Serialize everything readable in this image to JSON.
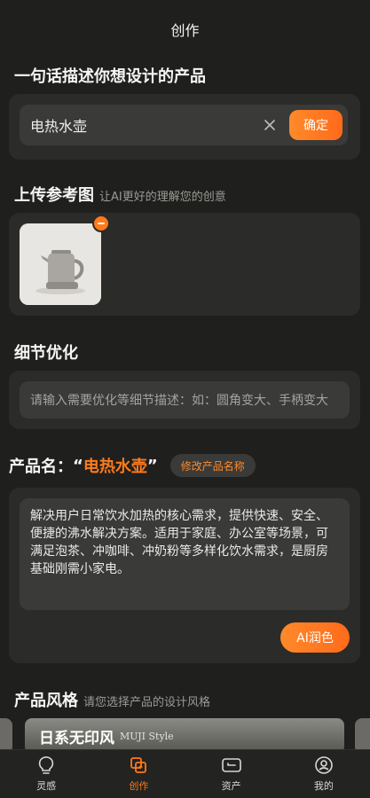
{
  "header": {
    "title": "创作"
  },
  "describe": {
    "title": "一句话描述你想设计的产品",
    "input_value": "电热水壶",
    "confirm_label": "确定"
  },
  "reference": {
    "title": "上传参考图",
    "hint": "让AI更好的理解您的创意",
    "image_icon": "kettle-image"
  },
  "detail": {
    "title": "细节优化",
    "placeholder": "请输入需要优化等细节描述：如：圆角变大、手柄变大"
  },
  "product": {
    "label": "产品名：",
    "open_quote": "“",
    "name": "电热水壶",
    "close_quote": "”",
    "rename_label": "修改产品名称",
    "description": "解决用户日常饮水加热的核心需求，提供快速、安全、便捷的沸水解决方案。适用于家庭、办公室等场景，可满足泡茶、冲咖啡、冲奶粉等多样化饮水需求，是厨房基础刚需小家电。",
    "polish_label": "AI润色"
  },
  "style": {
    "title": "产品风格",
    "hint": "请您选择产品的设计风格",
    "cards": [
      {
        "name": "日系无印风",
        "en": "MUJI Style"
      }
    ]
  },
  "tabbar": {
    "items": [
      {
        "label": "灵感",
        "icon": "lightbulb-icon"
      },
      {
        "label": "创作",
        "icon": "create-icon"
      },
      {
        "label": "资产",
        "icon": "wallet-icon"
      },
      {
        "label": "我的",
        "icon": "user-icon"
      }
    ]
  },
  "colors": {
    "accent": "#ff7a1a",
    "background": "#1f1f1d",
    "card": "#2b2b29"
  }
}
